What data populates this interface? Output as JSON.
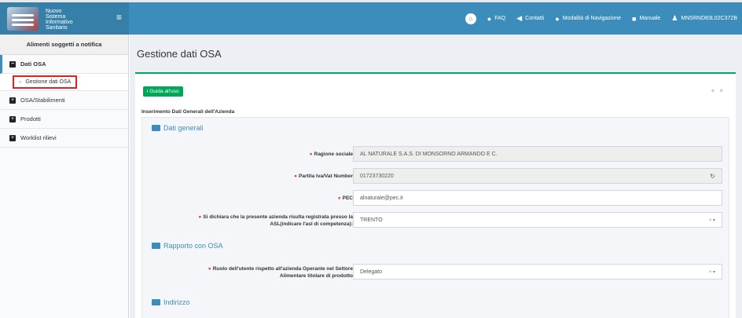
{
  "app": {
    "logo_lines": [
      "Nuovo",
      "Sistema",
      "Informativo",
      "Sanitario"
    ],
    "menu_toggle": "≡"
  },
  "nav": {
    "faq": "FAQ",
    "contatti": "Contatti",
    "modalita": "Modalità di Navigazione",
    "manuale": "Manuale",
    "user": "MNSRND83L02C372B"
  },
  "sidebar": {
    "header": "Alimenti soggetti a notifica",
    "items": [
      {
        "label": "Dati OSA",
        "icon": "minus-square-icon",
        "active": true
      },
      {
        "label": "OSA/Stabilimenti",
        "icon": "plus-square-icon"
      },
      {
        "label": "Prodotti",
        "icon": "plus-square-icon"
      },
      {
        "label": "Worklist rilievi",
        "icon": "plus-square-icon"
      }
    ],
    "sub_active": "Gestione dati OSA"
  },
  "page": {
    "title": "Gestione dati OSA",
    "guide_button": "i Guida all'uso",
    "subtitle": "Inserimento Dati Generali dell'Azienda"
  },
  "sections": {
    "dati_generali": "Dati generali",
    "rapporto": "Rapporto con OSA",
    "indirizzo": "Indirizzo"
  },
  "fields": {
    "ragione_sociale": {
      "label": "Ragione sociale",
      "value": "AL NATURALE S.A.S. DI MONSORNO ARMANDO E C."
    },
    "partita_iva": {
      "label": "Partita Iva/Vat Number",
      "value": "01723730220"
    },
    "pec": {
      "label": "PEC",
      "value": "alnaturale@pec.it"
    },
    "asl": {
      "label_line1": "Si dichiara che la presente azienda risulta registrata presso la",
      "label_line2": "ASL(indicare l'asl di competenza):",
      "value": "TRENTO"
    },
    "ruolo": {
      "label_line1": "Ruolo dell'utente rispetto all'azienda Operante nel Settore",
      "label_line2": "Alimentare titolare di prodotto",
      "value": "Delegato"
    }
  },
  "colors": {
    "topbar": "#3c8dbc",
    "accent_green": "#00a65a",
    "required": "#dd4b39",
    "highlight": "#dd2222"
  }
}
